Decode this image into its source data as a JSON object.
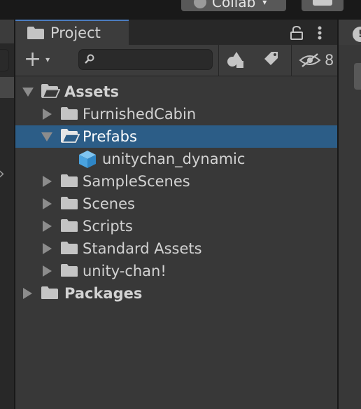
{
  "topbar": {
    "collab_label": "Collab",
    "collab_caret": "▾"
  },
  "project_window": {
    "tab_label": "Project",
    "hidden_count": "8",
    "search": {
      "placeholder": "",
      "value": ""
    },
    "add_caret": "▾"
  },
  "tree": {
    "assets": "Assets",
    "items": [
      {
        "label": "FurnishedCabin"
      },
      {
        "label": "Prefabs"
      },
      {
        "label": "unitychan_dynamic"
      },
      {
        "label": "SampleScenes"
      },
      {
        "label": "Scenes"
      },
      {
        "label": "Scripts"
      },
      {
        "label": "Standard Assets"
      },
      {
        "label": "unity-chan!"
      }
    ],
    "packages": "Packages"
  },
  "colors": {
    "selection": "#2c5d87",
    "panel": "#383838",
    "toolbar": "#3c3c3c",
    "tab_accent": "#4c7dc0",
    "prefab_icon": "#4aa3e0"
  },
  "icons": {
    "folder": "folder-icon",
    "folder_open": "folder-open-icon",
    "prefab": "prefab-cube-icon",
    "lock": "lock-icon",
    "menu": "kebab-menu-icon",
    "search": "search-icon",
    "type_filter": "type-filter-icon",
    "label_filter": "label-tag-icon",
    "hidden": "eye-slash-icon"
  }
}
